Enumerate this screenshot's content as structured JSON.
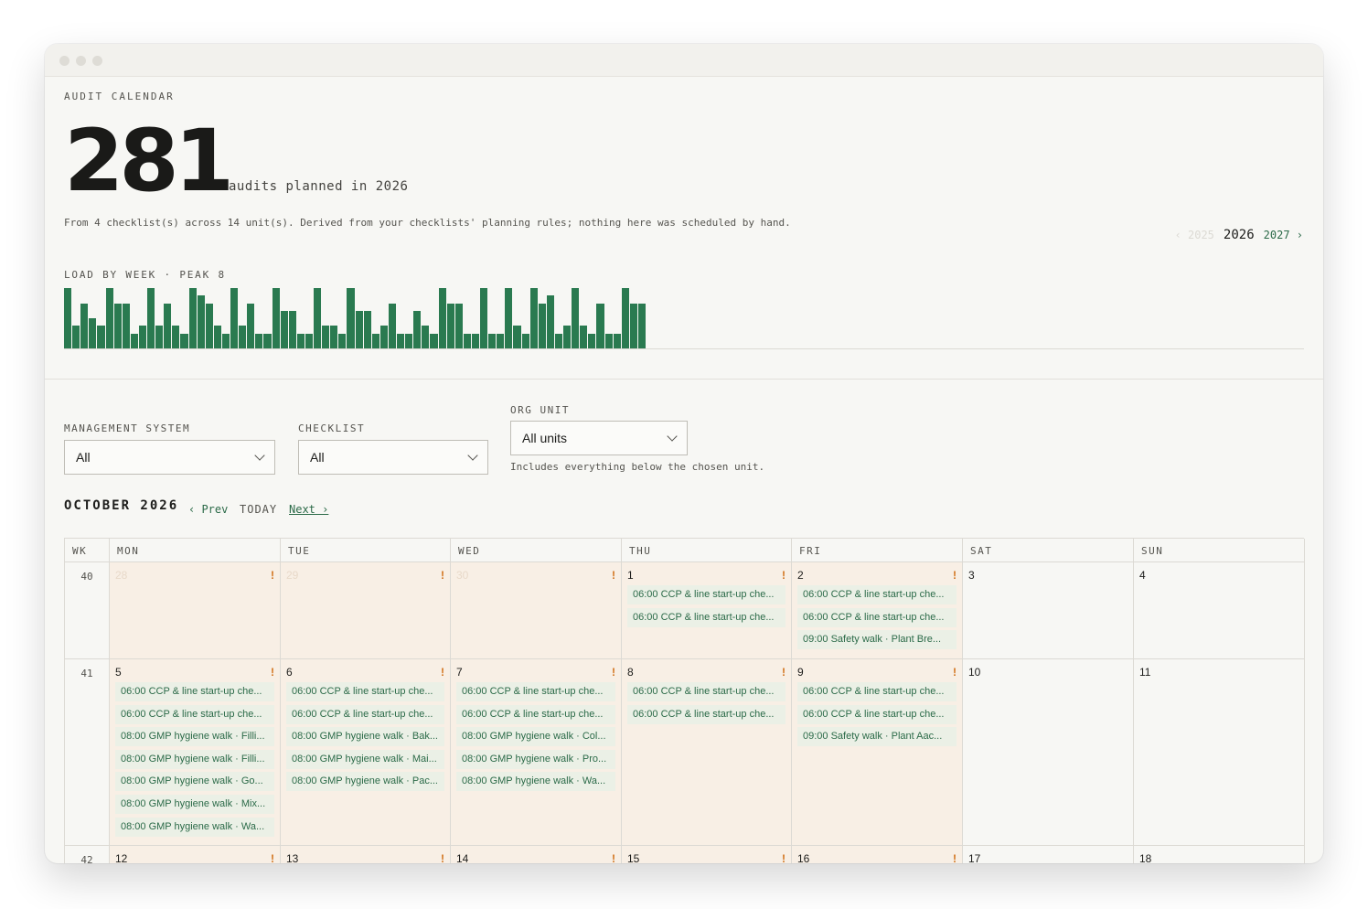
{
  "header": {
    "eyebrow": "AUDIT CALENDAR",
    "total": "281",
    "total_caption": "audits planned in 2026",
    "description": "From 4 checklist(s) across 14 unit(s). Derived from your checklists' planning rules; nothing here was scheduled by hand."
  },
  "years": {
    "prev": "‹ 2025",
    "current": "2026",
    "next": "2027 ›"
  },
  "load": {
    "label": "LOAD BY WEEK · PEAK 8",
    "peak": 8,
    "weeks": [
      8,
      3,
      6,
      4,
      3,
      8,
      6,
      6,
      2,
      3,
      8,
      3,
      6,
      3,
      2,
      8,
      7,
      6,
      3,
      2,
      8,
      3,
      6,
      2,
      2,
      9,
      5,
      5,
      2,
      2,
      9,
      3,
      3,
      2,
      9,
      5,
      5,
      2,
      3,
      6,
      2,
      2,
      5,
      3,
      2,
      8,
      6,
      6,
      2,
      2,
      8,
      2,
      2,
      8,
      3,
      2,
      8,
      6,
      7,
      2,
      3,
      8,
      3,
      2,
      6,
      2,
      2,
      8,
      6,
      6
    ]
  },
  "filters": {
    "management_system": {
      "label": "MANAGEMENT SYSTEM",
      "value": "All"
    },
    "checklist": {
      "label": "CHECKLIST",
      "value": "All"
    },
    "org_unit": {
      "label": "ORG UNIT",
      "value": "All units",
      "hint": "Includes everything below the chosen unit."
    }
  },
  "month_nav": {
    "title": "OCTOBER 2026",
    "prev": "‹ Prev",
    "today": "TODAY",
    "next": "Next ›"
  },
  "calendar": {
    "headers": [
      "WK",
      "MON",
      "TUE",
      "WED",
      "THU",
      "FRI",
      "SAT",
      "SUN"
    ],
    "weeks": [
      {
        "wk": "40",
        "height": 106,
        "days": [
          {
            "num": "28",
            "out": true,
            "warn": "!",
            "events": []
          },
          {
            "num": "29",
            "out": true,
            "warn": "!",
            "events": []
          },
          {
            "num": "30",
            "out": true,
            "warn": "!",
            "events": []
          },
          {
            "num": "1",
            "warn": "!",
            "events": [
              "06:00 CCP & line start-up che...",
              "06:00 CCP & line start-up che..."
            ]
          },
          {
            "num": "2",
            "warn": "!",
            "events": [
              "06:00 CCP & line start-up che...",
              "06:00 CCP & line start-up che...",
              "09:00 Safety walk · Plant Bre..."
            ]
          },
          {
            "num": "3",
            "weekend": true,
            "events": []
          },
          {
            "num": "4",
            "weekend": true,
            "events": []
          }
        ]
      },
      {
        "wk": "41",
        "height": 204,
        "days": [
          {
            "num": "5",
            "warn": "!",
            "events": [
              "06:00 CCP & line start-up che...",
              "06:00 CCP & line start-up che...",
              "08:00 GMP hygiene walk · Filli...",
              "08:00 GMP hygiene walk · Filli...",
              "08:00 GMP hygiene walk · Go...",
              "08:00 GMP hygiene walk · Mix...",
              "08:00 GMP hygiene walk · Wa..."
            ]
          },
          {
            "num": "6",
            "warn": "!",
            "events": [
              "06:00 CCP & line start-up che...",
              "06:00 CCP & line start-up che...",
              "08:00 GMP hygiene walk · Bak...",
              "08:00 GMP hygiene walk · Mai...",
              "08:00 GMP hygiene walk · Pac..."
            ]
          },
          {
            "num": "7",
            "warn": "!",
            "events": [
              "06:00 CCP & line start-up che...",
              "06:00 CCP & line start-up che...",
              "08:00 GMP hygiene walk · Col...",
              "08:00 GMP hygiene walk · Pro...",
              "08:00 GMP hygiene walk · Wa..."
            ]
          },
          {
            "num": "8",
            "warn": "!",
            "events": [
              "06:00 CCP & line start-up che...",
              "06:00 CCP & line start-up che..."
            ]
          },
          {
            "num": "9",
            "warn": "!",
            "events": [
              "06:00 CCP & line start-up che...",
              "06:00 CCP & line start-up che...",
              "09:00 Safety walk · Plant Aac..."
            ]
          },
          {
            "num": "10",
            "weekend": true,
            "events": []
          },
          {
            "num": "11",
            "weekend": true,
            "events": []
          }
        ]
      },
      {
        "wk": "42",
        "height": 60,
        "days": [
          {
            "num": "12",
            "warn": "!",
            "events": []
          },
          {
            "num": "13",
            "warn": "!",
            "events": []
          },
          {
            "num": "14",
            "warn": "!",
            "events": []
          },
          {
            "num": "15",
            "warn": "!",
            "events": []
          },
          {
            "num": "16",
            "warn": "!",
            "events": []
          },
          {
            "num": "17",
            "weekend": true,
            "events": []
          },
          {
            "num": "18",
            "weekend": true,
            "events": []
          }
        ]
      }
    ]
  },
  "colors": {
    "accent": "#2b6a48",
    "bar": "#2a7a50",
    "weekday_bg": "#f8efe5",
    "event_bg": "#ebf0e6",
    "warn": "#d2731c"
  }
}
